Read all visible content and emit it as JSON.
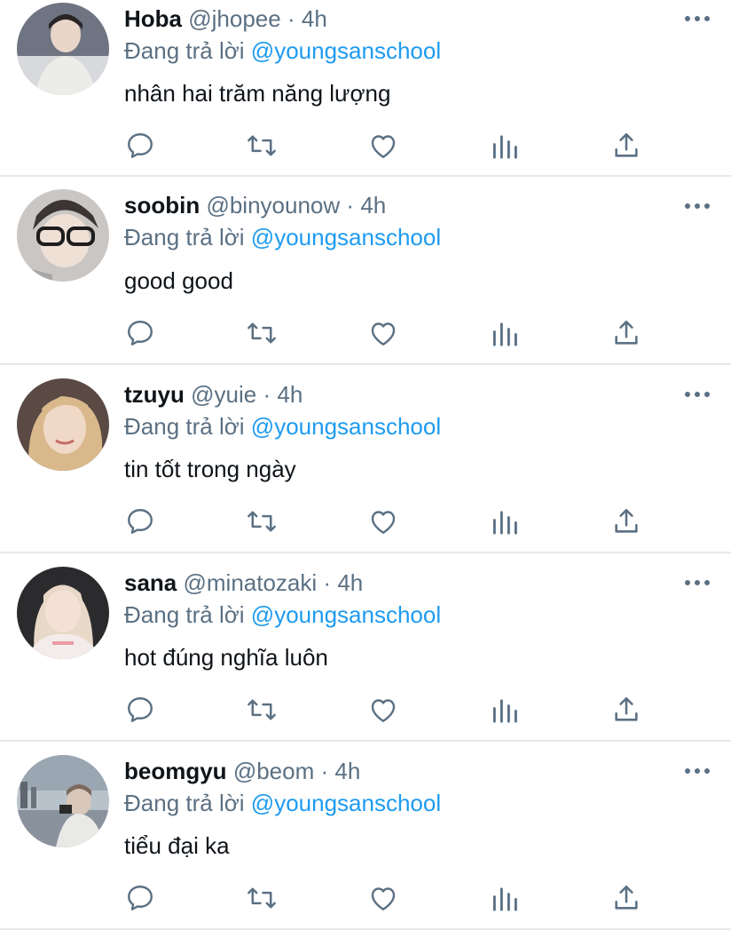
{
  "tweets": [
    {
      "name": "Hoba",
      "handle": "@jhopee",
      "sep": "·",
      "time": "4h",
      "reply_prefix": "Đang trả lời",
      "reply_to": "@youngsanschool",
      "text": "nhân hai trăm năng lượng",
      "avatar": {
        "bg": "#6e7481",
        "skin": "#e9d6c8",
        "hair": "#2a2426"
      }
    },
    {
      "name": "soobin",
      "handle": "@binyounow",
      "sep": "·",
      "time": "4h",
      "reply_prefix": "Đang trả lời",
      "reply_to": "@youngsanschool",
      "text": "good good",
      "avatar": {
        "bg": "#c9c6c4",
        "skin": "#efe0d6",
        "hair": "#3b3536"
      }
    },
    {
      "name": "tzuyu",
      "handle": "@yuie",
      "sep": "·",
      "time": "4h",
      "reply_prefix": "Đang trả lời",
      "reply_to": "@youngsanschool",
      "text": "tin tốt trong ngày",
      "avatar": {
        "bg": "#5a4a43",
        "skin": "#f0d8c6",
        "hair": "#d9b98c"
      }
    },
    {
      "name": "sana",
      "handle": "@minatozaki",
      "sep": "·",
      "time": "4h",
      "reply_prefix": "Đang trả lời",
      "reply_to": "@youngsanschool",
      "text": "hot đúng nghĩa luôn",
      "avatar": {
        "bg": "#2b2b2d",
        "skin": "#f3e1d6",
        "hair": "#e8d8c8"
      }
    },
    {
      "name": "beomgyu",
      "handle": "@beom",
      "sep": "·",
      "time": "4h",
      "reply_prefix": "Đang trả lời",
      "reply_to": "@youngsanschool",
      "text": "tiểu đại ka",
      "avatar": {
        "bg": "#b8c2cb",
        "skin": "#d9c7b9",
        "hair": "#7b6a5d"
      }
    }
  ],
  "icons": {
    "more": "more-horizontal-icon",
    "reply": "reply-icon",
    "retweet": "retweet-icon",
    "like": "heart-icon",
    "views": "analytics-icon",
    "share": "share-icon"
  },
  "colors": {
    "text": "#0f1419",
    "muted": "#5b7083",
    "mention": "#1d9bf0",
    "divider": "#e8e8e8"
  }
}
